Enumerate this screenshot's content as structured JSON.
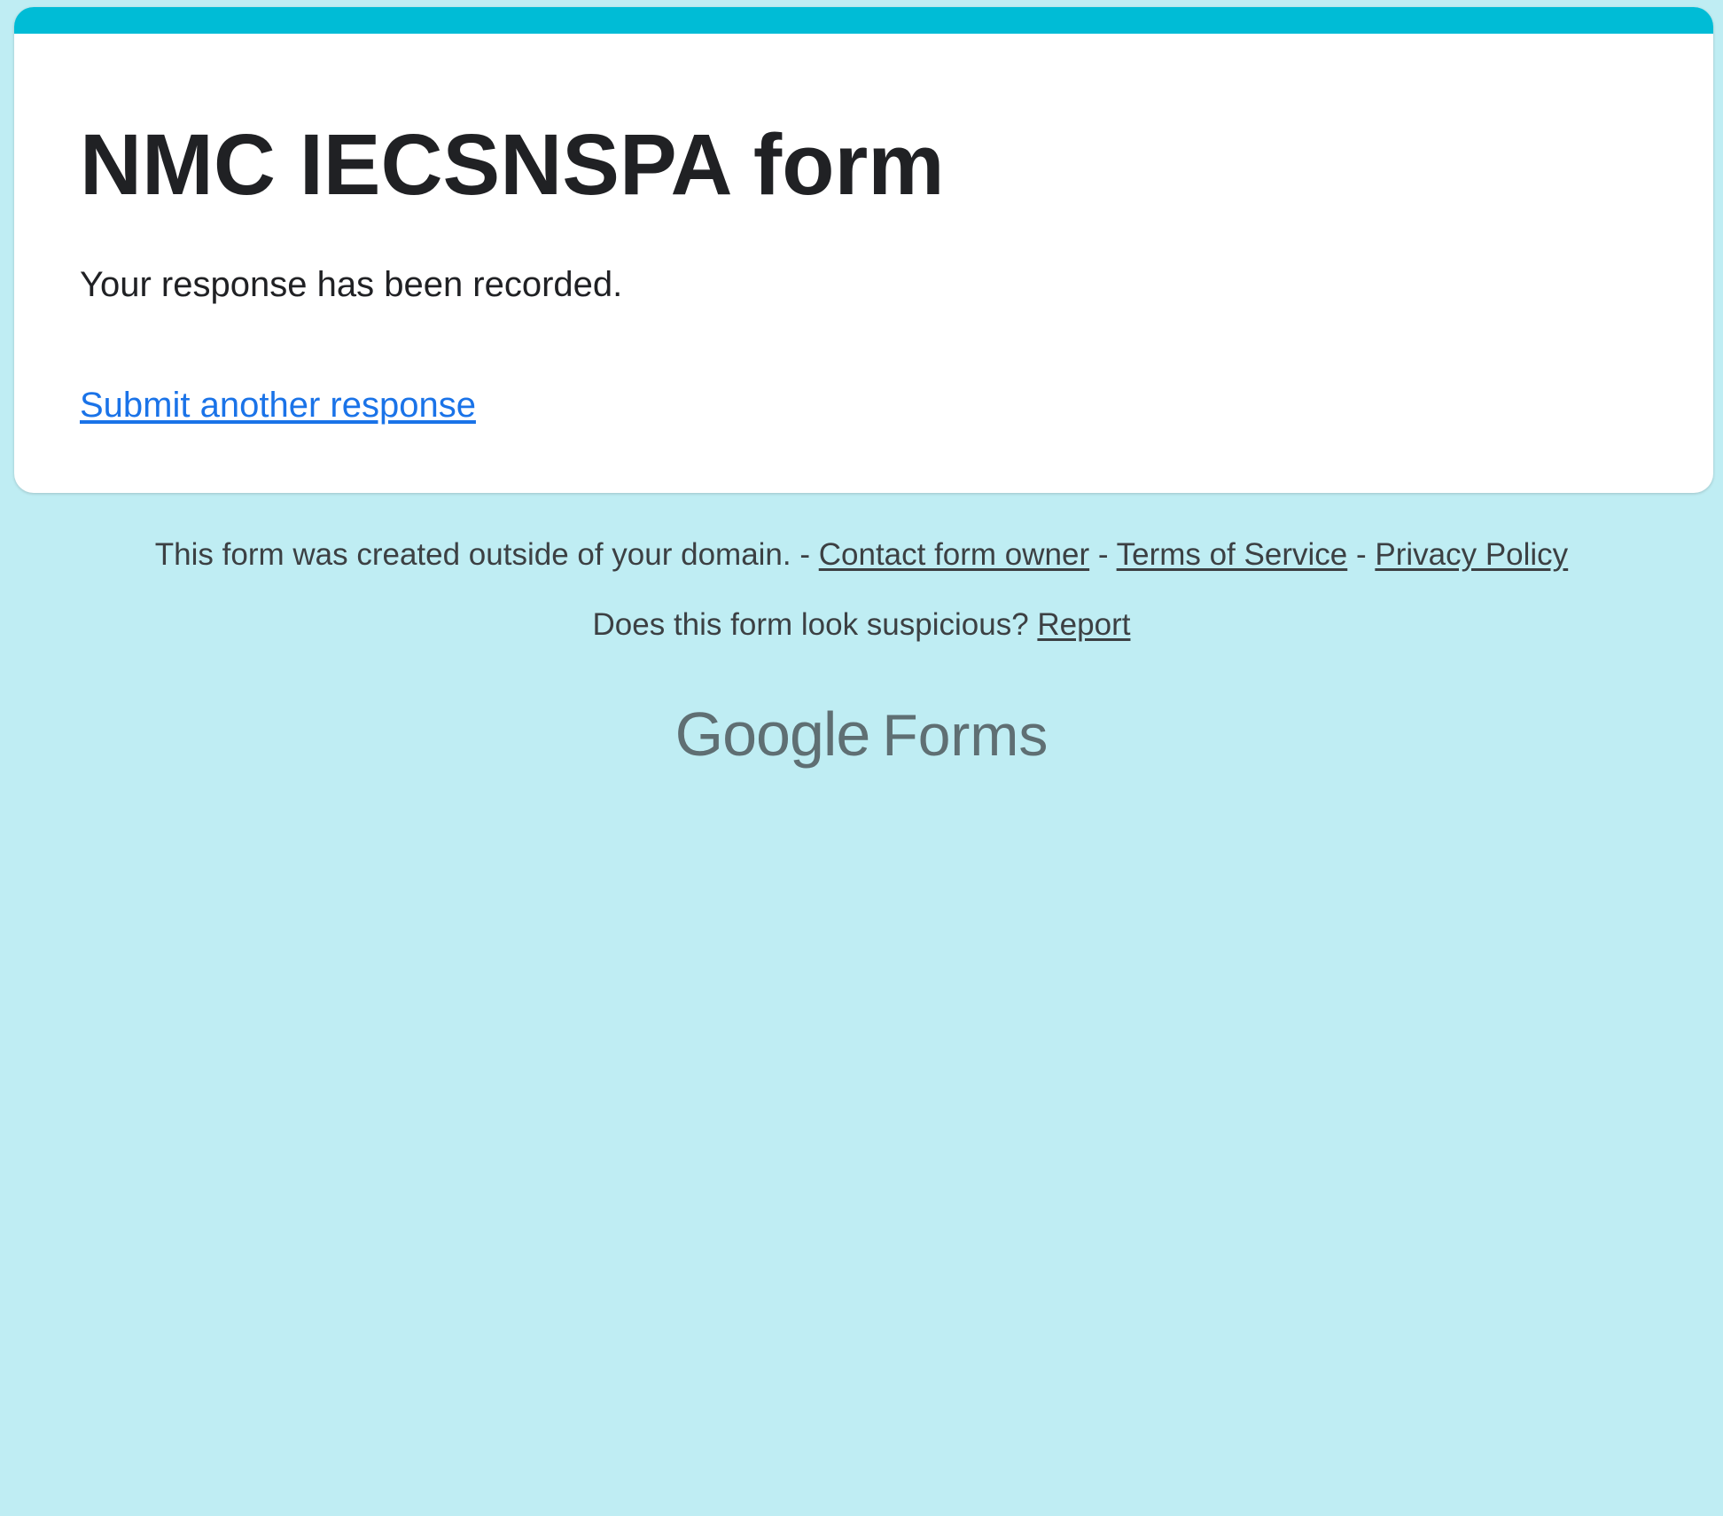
{
  "form": {
    "title": "NMC IECSNSPA form",
    "confirmation_message": "Your response has been recorded.",
    "submit_another_label": "Submit another response"
  },
  "footer": {
    "domain_notice": "This form was created outside of your domain.",
    "separator": " - ",
    "contact_owner_label": "Contact form owner",
    "terms_label": "Terms of Service",
    "privacy_label": "Privacy Policy",
    "suspicious_prompt": "Does this form look suspicious?",
    "report_label": "Report"
  },
  "branding": {
    "google": "Google",
    "product": "Forms"
  },
  "colors": {
    "page_background": "#bfedf3",
    "accent": "#00bcd6",
    "link": "#1a73e8",
    "text": "#202124",
    "footer_text": "#3c4043"
  }
}
